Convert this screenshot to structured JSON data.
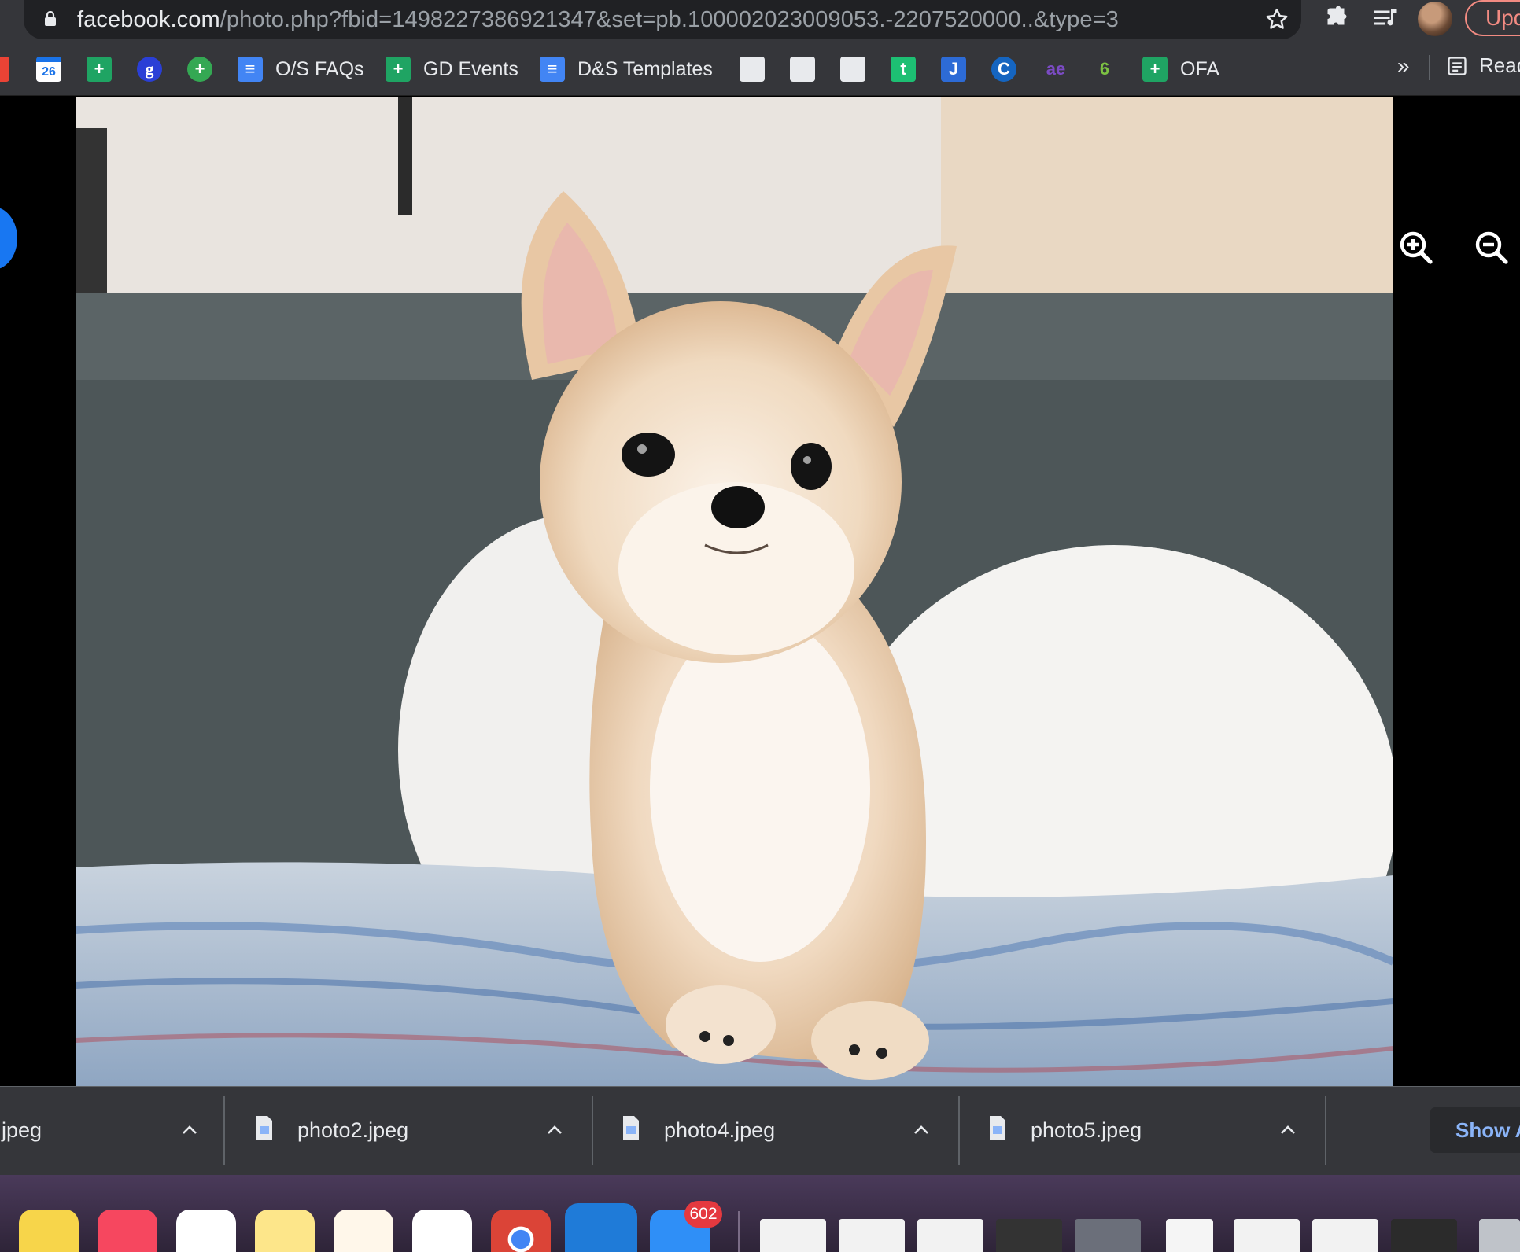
{
  "browser": {
    "url_host": "facebook.com",
    "url_path": "/photo.php?fbid=1498227386921347&set=pb.100002023009053.-2207520000..&type=3",
    "update_label": "Upd"
  },
  "bookmarks": {
    "items": [
      {
        "label": "",
        "icon": "gmail-icon"
      },
      {
        "label": "",
        "icon": "calendar-icon",
        "glyph": "26"
      },
      {
        "label": "",
        "icon": "sheets-icon",
        "glyph": "+"
      },
      {
        "label": "",
        "icon": "g-icon",
        "glyph": "g"
      },
      {
        "label": "",
        "icon": "plus-circle-icon",
        "glyph": "+"
      },
      {
        "label": "O/S FAQs",
        "icon": "docs-icon"
      },
      {
        "label": "GD Events",
        "icon": "sheets-icon"
      },
      {
        "label": "D&S Templates",
        "icon": "docs-icon"
      },
      {
        "label": "",
        "icon": "grid-icon"
      },
      {
        "label": "",
        "icon": "grid-icon"
      },
      {
        "label": "",
        "icon": "grid-icon"
      },
      {
        "label": "",
        "icon": "t-icon",
        "glyph": "t"
      },
      {
        "label": "",
        "icon": "j-icon",
        "glyph": "J"
      },
      {
        "label": "",
        "icon": "c-circle-icon",
        "glyph": "C"
      },
      {
        "label": "",
        "icon": "ae-icon",
        "glyph": "ae"
      },
      {
        "label": "",
        "icon": "leaf-icon",
        "glyph": "6"
      },
      {
        "label": "OFA",
        "icon": "sheets-icon"
      }
    ],
    "more_label": "»",
    "reading_list_label": "Read"
  },
  "downloads": {
    "items": [
      {
        "name": "jpeg"
      },
      {
        "name": "photo2.jpeg"
      },
      {
        "name": "photo4.jpeg"
      },
      {
        "name": "photo5.jpeg"
      }
    ],
    "show_all_label": "Show A"
  },
  "dock": {
    "mail_badge": "602"
  },
  "colors": {
    "chrome_bg": "#35363a",
    "omnibox_bg": "#202124",
    "accent_blue": "#8ab4f8",
    "update_red": "#f28b82"
  }
}
